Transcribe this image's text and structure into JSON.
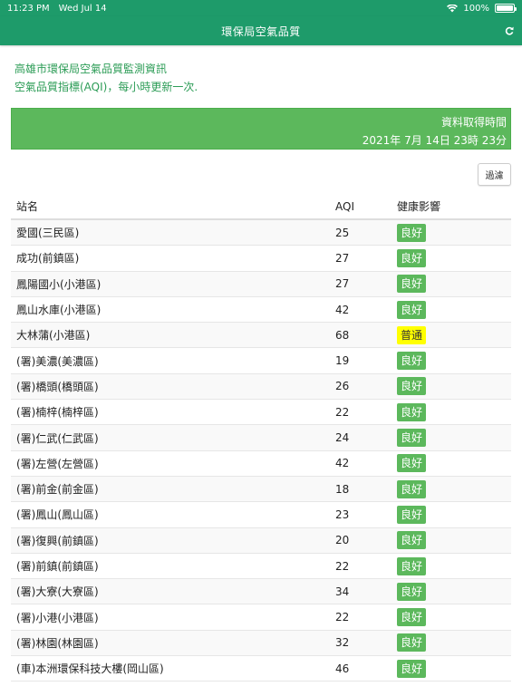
{
  "status_bar": {
    "time": "11:23 PM",
    "date": "Wed Jul 14",
    "battery": "100%"
  },
  "nav": {
    "title": "環保局空氣品質"
  },
  "intro": {
    "line1": "高雄市環保局空氣品質監測資訊",
    "line2": "空氣品質指標(AQI)，每小時更新一次."
  },
  "fetch": {
    "label": "資料取得時間",
    "datetime": "2021年 7月 14日 23時 23分"
  },
  "filter_label": "過濾",
  "table": {
    "headers": {
      "station": "站名",
      "aqi": "AQI",
      "health": "健康影響"
    },
    "rows": [
      {
        "station": "愛國(三民區)",
        "aqi": "25",
        "health": "良好",
        "level": "good"
      },
      {
        "station": "成功(前鎮區)",
        "aqi": "27",
        "health": "良好",
        "level": "good"
      },
      {
        "station": "鳳陽國小(小港區)",
        "aqi": "27",
        "health": "良好",
        "level": "good"
      },
      {
        "station": "鳳山水庫(小港區)",
        "aqi": "42",
        "health": "良好",
        "level": "good"
      },
      {
        "station": "大林蒲(小港區)",
        "aqi": "68",
        "health": "普通",
        "level": "moderate"
      },
      {
        "station": "(署)美濃(美濃區)",
        "aqi": "19",
        "health": "良好",
        "level": "good"
      },
      {
        "station": "(署)橋頭(橋頭區)",
        "aqi": "26",
        "health": "良好",
        "level": "good"
      },
      {
        "station": "(署)楠梓(楠梓區)",
        "aqi": "22",
        "health": "良好",
        "level": "good"
      },
      {
        "station": "(署)仁武(仁武區)",
        "aqi": "24",
        "health": "良好",
        "level": "good"
      },
      {
        "station": "(署)左營(左營區)",
        "aqi": "42",
        "health": "良好",
        "level": "good"
      },
      {
        "station": "(署)前金(前金區)",
        "aqi": "18",
        "health": "良好",
        "level": "good"
      },
      {
        "station": "(署)鳳山(鳳山區)",
        "aqi": "23",
        "health": "良好",
        "level": "good"
      },
      {
        "station": "(署)復興(前鎮區)",
        "aqi": "20",
        "health": "良好",
        "level": "good"
      },
      {
        "station": "(署)前鎮(前鎮區)",
        "aqi": "22",
        "health": "良好",
        "level": "good"
      },
      {
        "station": "(署)大寮(大寮區)",
        "aqi": "34",
        "health": "良好",
        "level": "good"
      },
      {
        "station": "(署)小港(小港區)",
        "aqi": "22",
        "health": "良好",
        "level": "good"
      },
      {
        "station": "(署)林園(林園區)",
        "aqi": "32",
        "health": "良好",
        "level": "good"
      },
      {
        "station": "(車)本洲環保科技大樓(岡山區)",
        "aqi": "46",
        "health": "良好",
        "level": "good"
      }
    ]
  },
  "icons": {
    "refresh": "refresh-icon",
    "wifi": "wifi-icon",
    "battery": "battery-icon"
  },
  "colors": {
    "accent": "#1e9b6a",
    "good": "#5cb85c",
    "moderate": "#ffff00",
    "intro_text": "#2c9c56"
  }
}
